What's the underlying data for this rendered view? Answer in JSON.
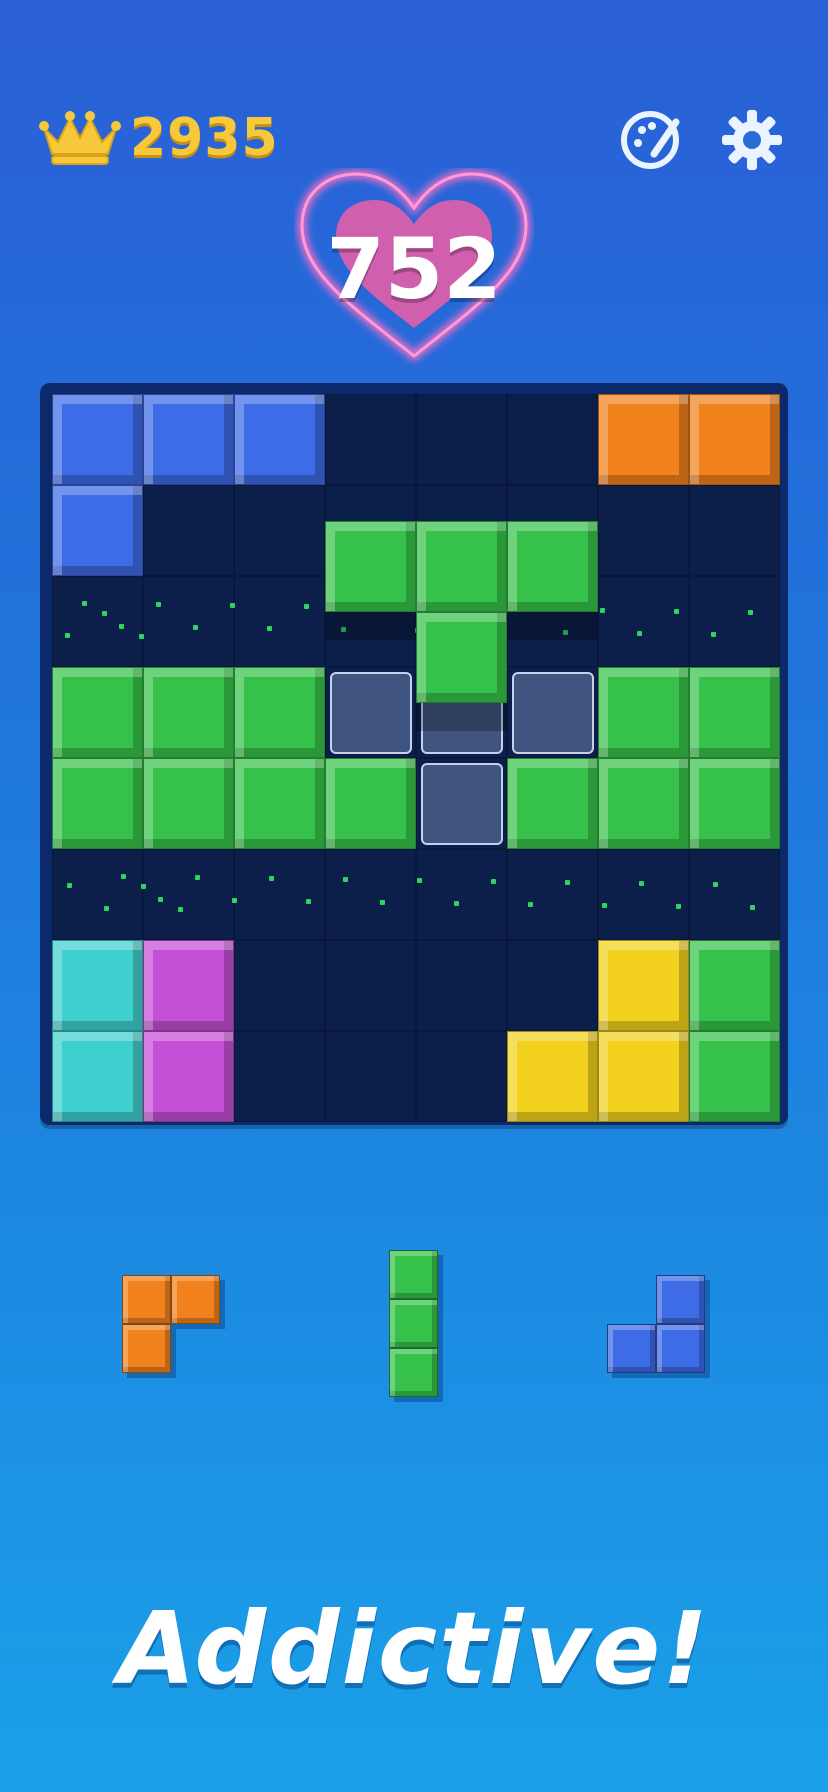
{
  "header": {
    "best_score": "2935",
    "crown_icon": "crown-icon",
    "theme_icon": "palette-icon",
    "settings_icon": "gear-icon"
  },
  "score": {
    "value": "752",
    "icon": "heart-icon"
  },
  "board": {
    "size": 8,
    "rows": [
      [
        "blue",
        "blue",
        "blue",
        null,
        null,
        null,
        "orange",
        "orange"
      ],
      [
        "blue",
        null,
        null,
        null,
        null,
        null,
        null,
        null
      ],
      [
        null,
        null,
        null,
        null,
        null,
        null,
        null,
        null
      ],
      [
        "green",
        "green",
        "green",
        null,
        null,
        null,
        "green",
        "green"
      ],
      [
        "green",
        "green",
        "green",
        "green",
        null,
        "green",
        "green",
        "green"
      ],
      [
        null,
        null,
        null,
        null,
        null,
        null,
        null,
        null
      ],
      [
        "cyan",
        "purple",
        null,
        null,
        null,
        null,
        "yellow",
        "green"
      ],
      [
        "cyan",
        "purple",
        null,
        null,
        null,
        "yellow",
        "yellow",
        "green"
      ]
    ],
    "ghost_cells": [
      [
        3,
        3
      ],
      [
        3,
        4
      ],
      [
        3,
        5
      ],
      [
        4,
        4
      ]
    ],
    "dragging_piece": {
      "color": "green",
      "cells": [
        [
          1.4,
          3
        ],
        [
          1.4,
          4
        ],
        [
          1.4,
          5
        ],
        [
          2.4,
          4
        ]
      ]
    }
  },
  "tray": [
    {
      "name": "orange-l-piece",
      "color": "orange",
      "cells": [
        [
          0,
          0
        ],
        [
          0,
          1
        ],
        [
          1,
          0
        ]
      ]
    },
    {
      "name": "green-i-piece",
      "color": "green",
      "cells": [
        [
          0,
          0
        ],
        [
          1,
          0
        ],
        [
          2,
          0
        ]
      ]
    },
    {
      "name": "blue-j-piece",
      "color": "blue",
      "cells": [
        [
          0,
          1
        ],
        [
          1,
          0
        ],
        [
          1,
          1
        ]
      ]
    }
  ],
  "colors": {
    "blue": "#3e6be6",
    "orange": "#f2821e",
    "green": "#36c24a",
    "cyan": "#40cfcf",
    "purple": "#c54fd6",
    "yellow": "#f2d21e",
    "gold": "#f7c93a",
    "heart": "#ee5ea6"
  },
  "tagline": "Addictive!"
}
